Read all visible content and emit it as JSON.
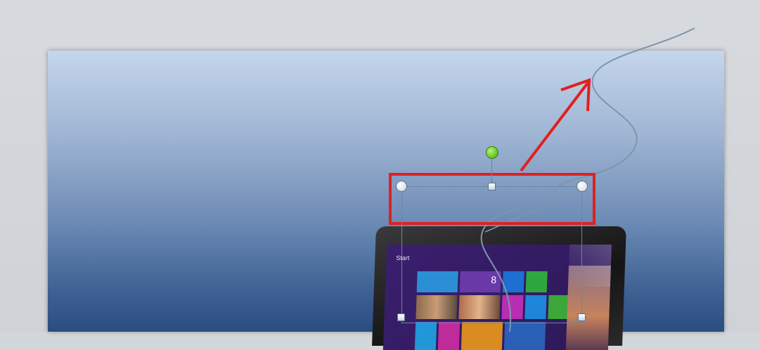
{
  "window": {
    "title": ""
  },
  "tablet": {
    "start_label": "Start",
    "tile_label": "8"
  },
  "colors": {
    "workspace_bg": "#d3d6da",
    "slide_top": "#c5d6ec",
    "slide_bottom": "#2a4c80",
    "selection_outline": "#6b86a6",
    "highlight_red": "#e02020",
    "rotate_handle_green": "#5fc21f",
    "curve_stroke": "#7f95ad"
  },
  "icons": {
    "rotation_handle": "rotate-handle-icon",
    "corner_handle": "corner-handle-icon",
    "edge_handle": "edge-handle-icon",
    "arrow_annotation": "red-arrow-icon"
  }
}
